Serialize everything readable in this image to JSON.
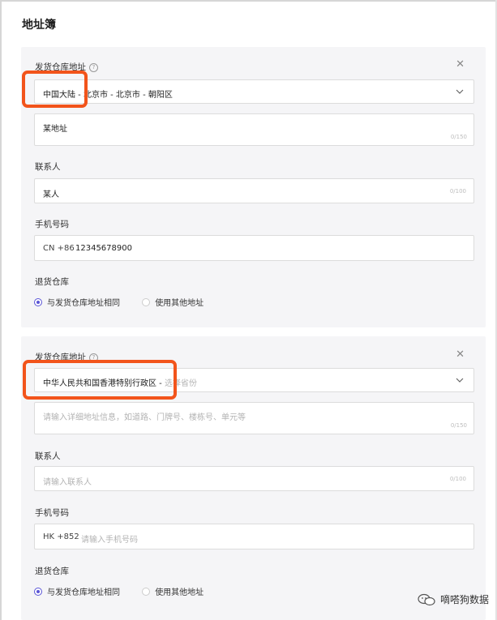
{
  "page": {
    "title": "地址簿"
  },
  "cards": [
    {
      "warehouse_label": "发货仓库地址",
      "region_value": "中国大陆 - 北京市 - 北京市 - 朝阳区",
      "region_placeholder": "",
      "address_value": "某地址",
      "address_counter": "0/150",
      "contact_label": "联系人",
      "contact_value": "某人",
      "contact_counter": "0/100",
      "phone_label": "手机号码",
      "phone_country_code": "CN +86",
      "phone_value": "12345678900",
      "return_label": "退货仓库",
      "radio_same": "与发货仓库地址相同",
      "radio_other": "使用其他地址",
      "selected": "same"
    },
    {
      "warehouse_label": "发货仓库地址",
      "region_value": "中华人民共和国香港特别行政区 -",
      "region_placeholder": "选择省份",
      "address_placeholder": "请输入详细地址信息，如道路、门牌号、楼栋号、单元等",
      "address_counter": "0/150",
      "contact_label": "联系人",
      "contact_placeholder": "请输入联系人",
      "contact_counter": "0/100",
      "phone_label": "手机号码",
      "phone_country_code": "HK +852",
      "phone_placeholder": "请输入手机号码",
      "return_label": "退货仓库",
      "radio_same": "与发货仓库地址相同",
      "radio_other": "使用其他地址",
      "selected": "same"
    }
  ],
  "watermark": {
    "text": "嘀嗒狗数据"
  },
  "colors": {
    "accent": "#5a55d6",
    "highlight": "#f2541b",
    "card_bg": "#f5f5f7"
  },
  "icons": [
    "help-icon",
    "close-icon",
    "chevron-down-icon",
    "wechat-icon"
  ]
}
